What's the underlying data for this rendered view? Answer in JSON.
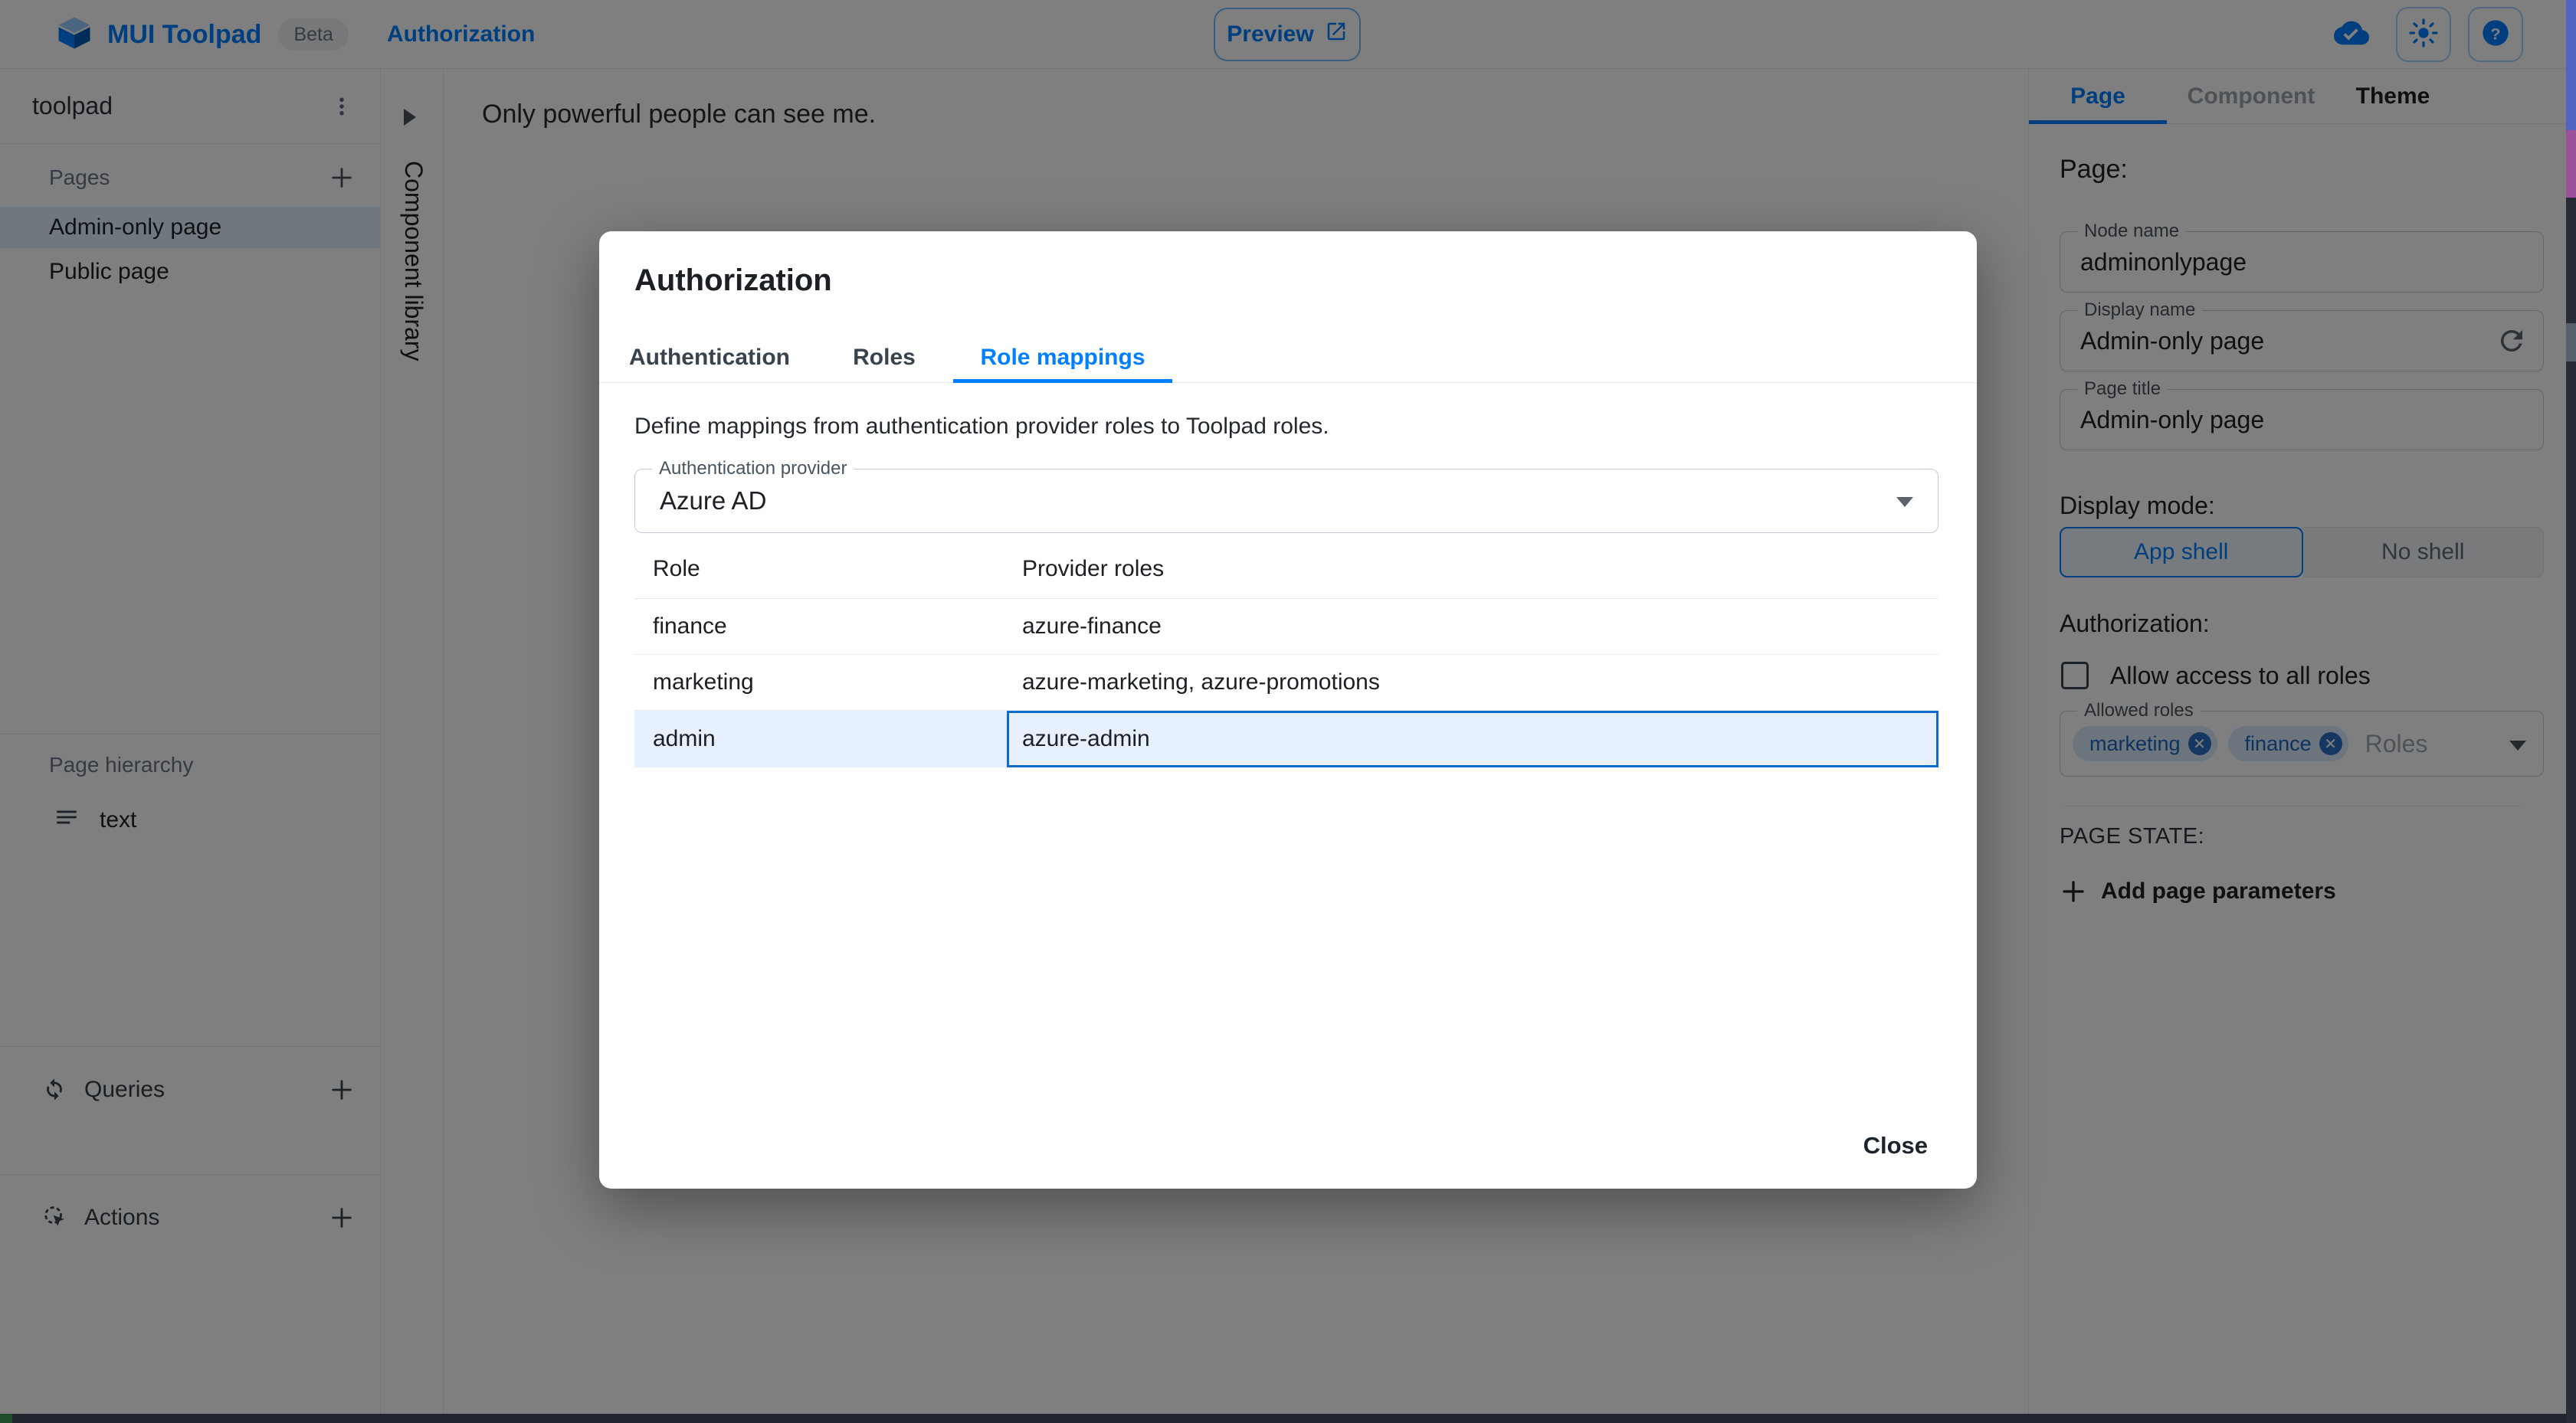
{
  "header": {
    "app_name": "MUI Toolpad",
    "beta_label": "Beta",
    "breadcrumb": "Authorization",
    "preview_label": "Preview"
  },
  "sidebar": {
    "project_name": "toolpad",
    "pages_label": "Pages",
    "pages": [
      {
        "label": "Admin-only page",
        "selected": true
      },
      {
        "label": "Public page",
        "selected": false
      }
    ],
    "hierarchy_label": "Page hierarchy",
    "hierarchy_items": [
      {
        "label": "text"
      }
    ],
    "queries_label": "Queries",
    "actions_label": "Actions"
  },
  "component_library": {
    "label": "Component library"
  },
  "canvas": {
    "text": "Only powerful people can see me."
  },
  "dialog": {
    "title": "Authorization",
    "tabs": [
      {
        "label": "Authentication",
        "active": false
      },
      {
        "label": "Roles",
        "active": false
      },
      {
        "label": "Role mappings",
        "active": true
      }
    ],
    "description": "Define mappings from authentication provider roles to Toolpad roles.",
    "provider_select": {
      "label": "Authentication provider",
      "value": "Azure AD"
    },
    "table": {
      "columns": [
        "Role",
        "Provider roles"
      ],
      "rows": [
        {
          "role": "finance",
          "providers": "azure-finance",
          "selected": false
        },
        {
          "role": "marketing",
          "providers": "azure-marketing, azure-promotions",
          "selected": false
        },
        {
          "role": "admin",
          "providers": "azure-admin",
          "selected": true
        }
      ]
    },
    "close_label": "Close"
  },
  "inspector": {
    "tabs": [
      {
        "label": "Page",
        "active": true
      },
      {
        "label": "Component",
        "active": false
      },
      {
        "label": "Theme",
        "active": false
      }
    ],
    "heading": "Page:",
    "node_name": {
      "label": "Node name",
      "value": "adminonlypage"
    },
    "display_name": {
      "label": "Display name",
      "value": "Admin-only page"
    },
    "page_title": {
      "label": "Page title",
      "value": "Admin-only page"
    },
    "display_mode_label": "Display mode:",
    "display_mode_options": [
      {
        "label": "App shell",
        "selected": true
      },
      {
        "label": "No shell",
        "selected": false
      }
    ],
    "authorization_label": "Authorization:",
    "allow_all_label": "Allow access to all roles",
    "allow_all_checked": false,
    "allowed_roles": {
      "label": "Allowed roles",
      "chips": [
        "marketing",
        "finance"
      ],
      "placeholder": "Roles"
    },
    "page_state_label": "PAGE STATE:",
    "add_parameters_label": "Add page parameters"
  },
  "colors": {
    "primary": "#007FFF",
    "selected_row_bg": "#E7F0FE",
    "cell_focus_border": "#0C6BCB",
    "selected_page_bg": "#E0F0FF",
    "chip_bg": "#D9E9FA",
    "chip_text": "#1B66BE",
    "overlay": "rgba(0,0,0,0.5)"
  }
}
